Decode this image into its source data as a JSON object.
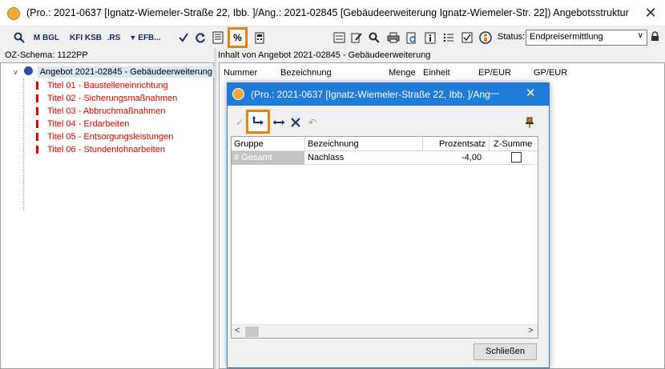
{
  "window": {
    "title": "(Pro.: 2021-0637 [Ignatz-Wiemeler-Straße 22, Ibb. ]/Ang.: 2021-02845 [Gebäudeerweiterung Ignatz-Wiemeler-Str. 22]) Angebotsstruktur",
    "close": "✕"
  },
  "toolbar": {
    "icons": [
      "search-icon",
      "m-bgl-icon",
      "kfi-ksb-icon",
      "rs-icon",
      "efb-icon",
      "check-icon",
      "refresh-icon",
      "document-icon",
      "percent-icon",
      "calculator-icon",
      "list-icon",
      "edit-icon",
      "search-icon",
      "print-icon",
      "preview-icon",
      "info-icon",
      "list-icon",
      "checkbox-icon",
      "person-icon",
      "lock-icon"
    ],
    "m_bgl_label": "M BGL",
    "kfi_ksb_label": "KFI KSB",
    "rs_label": ".RS",
    "efb_label": "EFB...",
    "percent_label": "%",
    "status_label": "Status:",
    "status_value": "Endpreisermittlung"
  },
  "left_pane": {
    "oz_schema": "OZ-Schema: 1122PP",
    "root_label": "Angebot 2021-02845 - Gebäudeerweiterung",
    "items": [
      "Titel 01 - Baustelleneinrichtung",
      "Titel 02 - Sicherungsmaßnahmen",
      "Titel 03 - Abbruchmaßnahmen",
      "Titel 04 - Erdarbeiten",
      "Titel 05 - Entsorgungsleistungen",
      "Titel 06 - Stundenlohnarbeiten"
    ]
  },
  "right_pane": {
    "label": "Inhalt von Angebot 2021-02845 - Gebäudeerweiterung",
    "columns": [
      "Nummer",
      "Bezeichnung",
      "Menge",
      "Einheit",
      "EP/EUR",
      "GP/EUR"
    ]
  },
  "modal": {
    "title": "(Pro.: 2021-0637 [Ignatz-Wiemeler-Straße 22, Ibb. ]/Ang",
    "minimize": "—",
    "close": "✕",
    "toolbar_icons": [
      "check-icon",
      "sort-icon",
      "arrows-icon",
      "cross-icon",
      "undo-icon",
      "pin-icon"
    ],
    "grid": {
      "columns": [
        "Gruppe",
        "Bezeichnung",
        "Prozentsatz",
        "Z-Summe"
      ],
      "rows": [
        {
          "gruppe": "# Gesamt",
          "bezeichnung": "Nachlass",
          "prozentsatz": "-4,00",
          "zsumme": false
        }
      ]
    },
    "close_button": "Schließen"
  },
  "colors": {
    "highlight": "#e8840c",
    "modal_title_bg": "#1e7bd7",
    "tree_item_red": "#e00000"
  }
}
